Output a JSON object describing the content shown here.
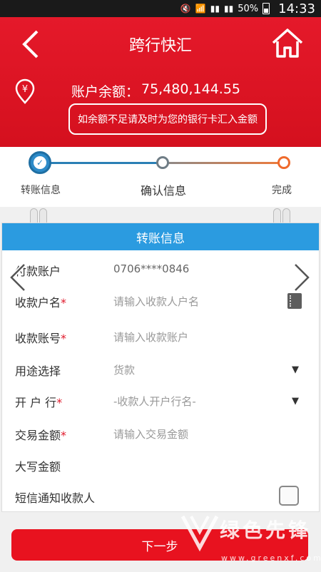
{
  "status_bar": {
    "battery": "50%",
    "time": "14:33"
  },
  "header": {
    "title": "跨行快汇",
    "balance_label": "账户余额：",
    "balance_value": "75,480,144.55",
    "notice": "如余额不足请及时为您的银行卡汇入金额"
  },
  "stepper": {
    "steps": [
      "转账信息",
      "确认信息",
      "完成"
    ],
    "current": 1
  },
  "card": {
    "heading": "转账信息",
    "rows": [
      {
        "label": "付款账户",
        "value": "0706****0846",
        "required": false
      },
      {
        "label": "收款户名",
        "placeholder": "请输入收款人户名",
        "required": true
      },
      {
        "label": "收款账号",
        "placeholder": "请输入收款账户",
        "required": true
      },
      {
        "label": "用途选择",
        "value": "货款",
        "required": false
      },
      {
        "label": "开 户 行",
        "placeholder": "-收款人开户行名-",
        "required": true
      },
      {
        "label": "交易金额",
        "placeholder": "请输入交易金额",
        "required": true
      },
      {
        "label": "大写金额",
        "value": "",
        "required": false
      },
      {
        "label": "短信通知收款人",
        "required": false
      }
    ],
    "required_mark": "*"
  },
  "next_button": "下一步",
  "watermark": {
    "text": "绿色先锋",
    "url": "www.greenxf.com"
  },
  "colors": {
    "brand_red": "#e5192a",
    "accent_blue": "#2b9be0",
    "done_orange": "#ef6a2c"
  }
}
